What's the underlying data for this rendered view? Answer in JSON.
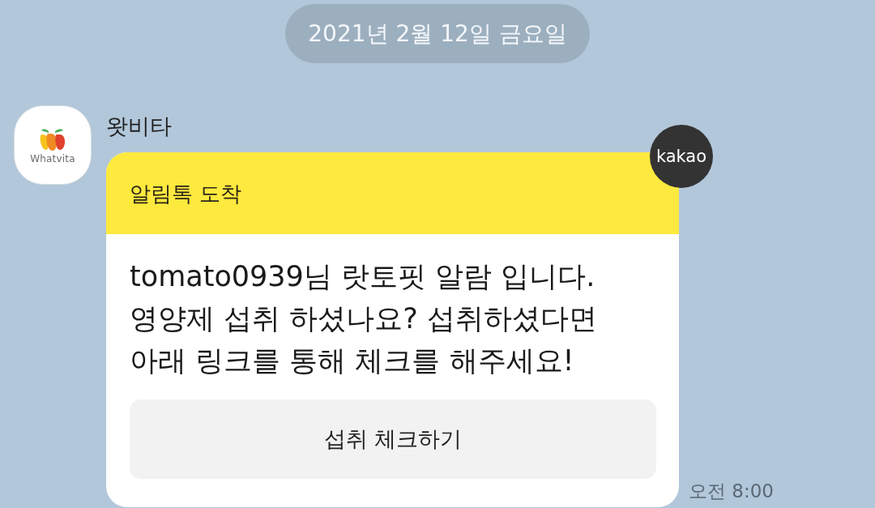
{
  "date_divider": "2021년 2월 12일 금요일",
  "message": {
    "sender": {
      "name": "왓비타",
      "avatar_logo_text": "Whatvita"
    },
    "card": {
      "header": "알림톡 도착",
      "body": "tomato0939님 랏토핏 알람 입니다.\n영양제 섭취 하셨나요? 섭취하셨다면\n아래 링크를 통해 체크를 해주세요!",
      "button": "섭취 체크하기",
      "badge": "kakao"
    },
    "time": "오전 8:00"
  }
}
